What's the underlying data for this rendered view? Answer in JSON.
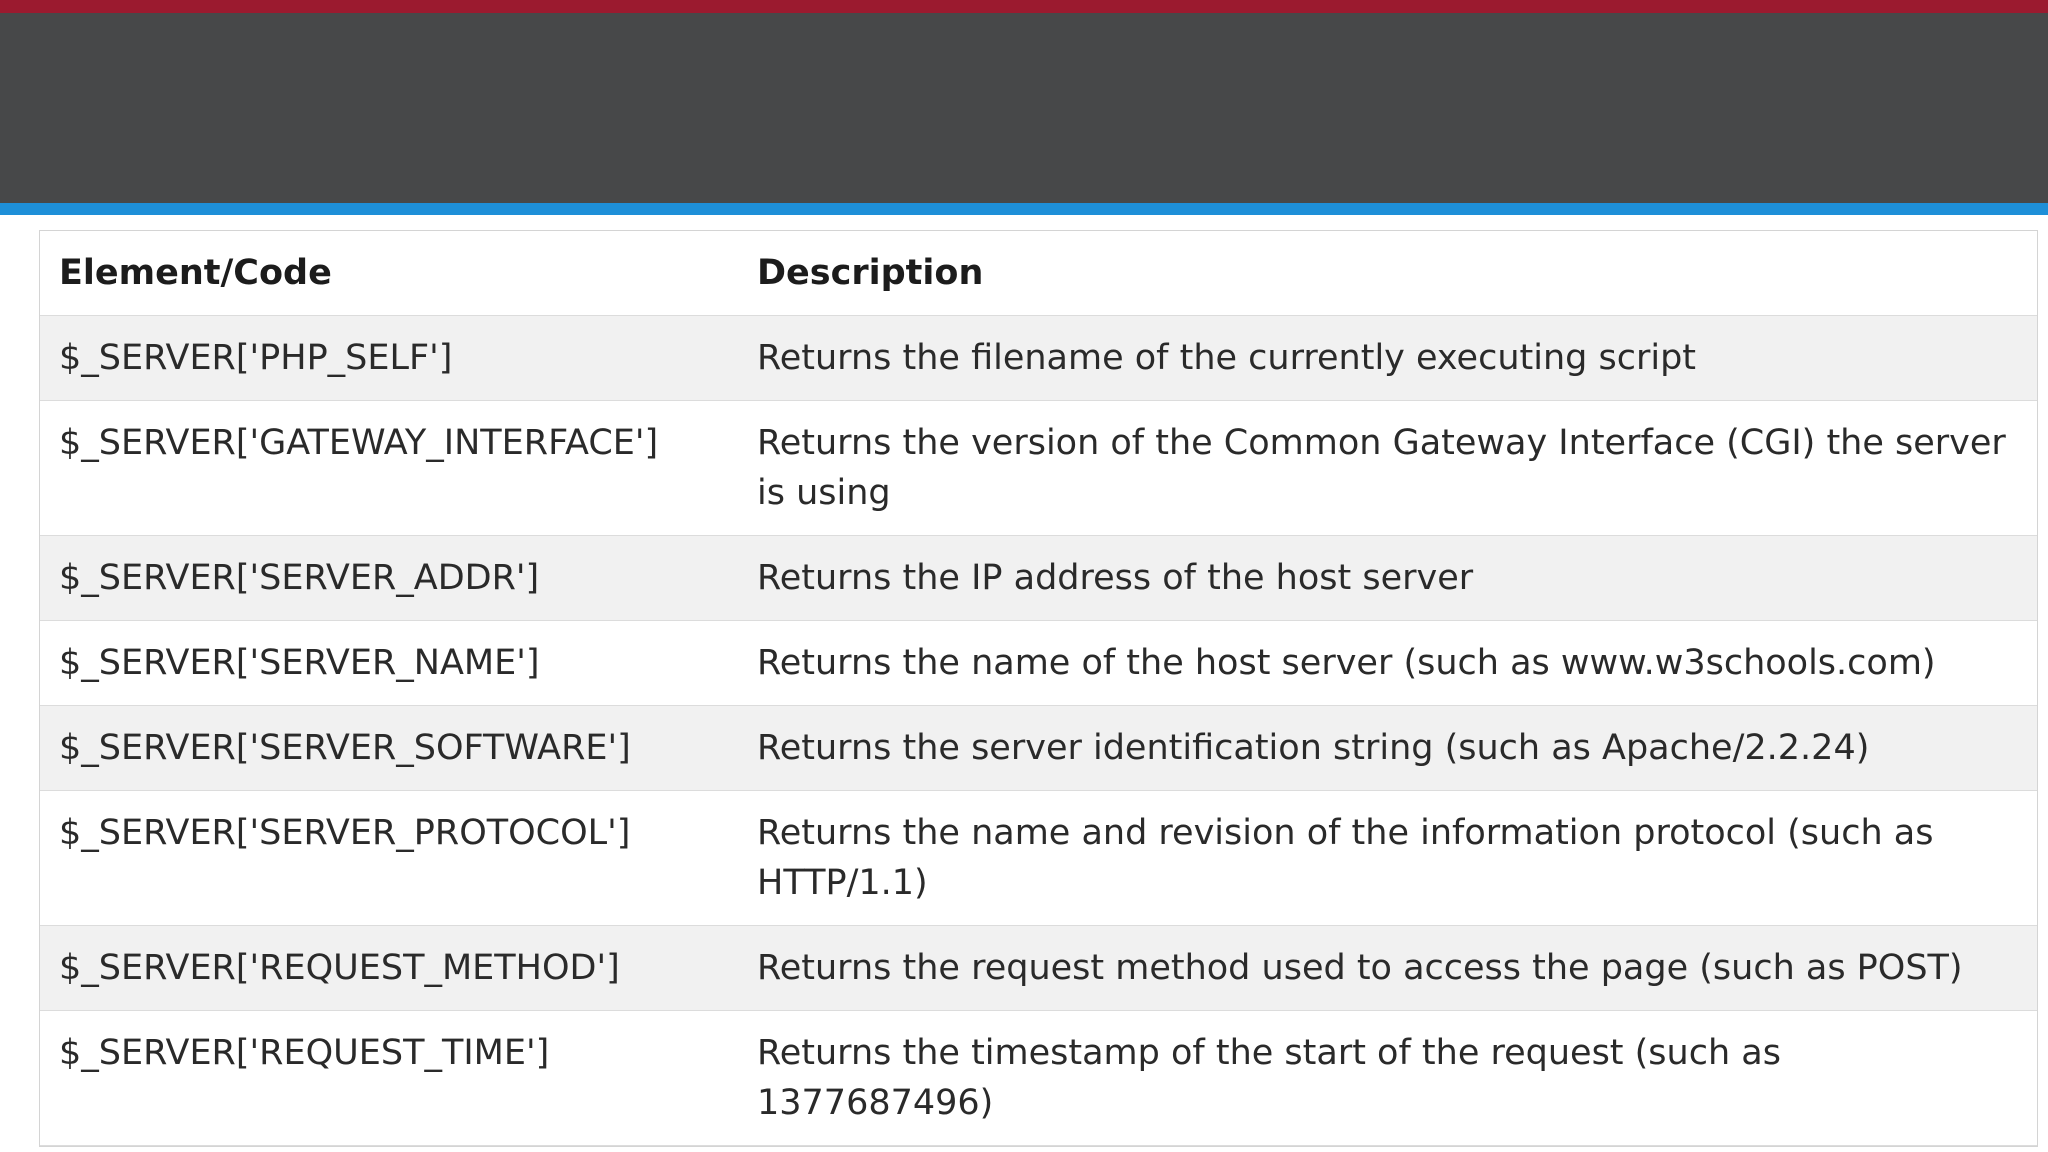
{
  "table": {
    "headers": [
      "Element/Code",
      "Description"
    ],
    "rows": [
      {
        "code": "$_SERVER['PHP_SELF']",
        "description": "Returns the filename of the currently executing script"
      },
      {
        "code": "$_SERVER['GATEWAY_INTERFACE']",
        "description": "Returns the version of the Common Gateway Interface (CGI) the server is using"
      },
      {
        "code": "$_SERVER['SERVER_ADDR']",
        "description": "Returns the IP address of the host server"
      },
      {
        "code": "$_SERVER['SERVER_NAME']",
        "description": "Returns the name of the host server (such as www.w3schools.com)"
      },
      {
        "code": "$_SERVER['SERVER_SOFTWARE']",
        "description": "Returns the server identification string (such as Apache/2.2.24)"
      },
      {
        "code": "$_SERVER['SERVER_PROTOCOL']",
        "description": "Returns the name and revision of the information protocol (such as HTTP/1.1)"
      },
      {
        "code": "$_SERVER['REQUEST_METHOD']",
        "description": "Returns the request method used to access the page (such as POST)"
      },
      {
        "code": "$_SERVER['REQUEST_TIME']",
        "description": "Returns the timestamp of the start of the request (such as 1377687496)"
      }
    ]
  },
  "colors": {
    "top_stripe": "#9b1a2f",
    "header_band": "#474849",
    "accent_stripe": "#1e8fd8",
    "row_alt": "#f1f1f1"
  }
}
